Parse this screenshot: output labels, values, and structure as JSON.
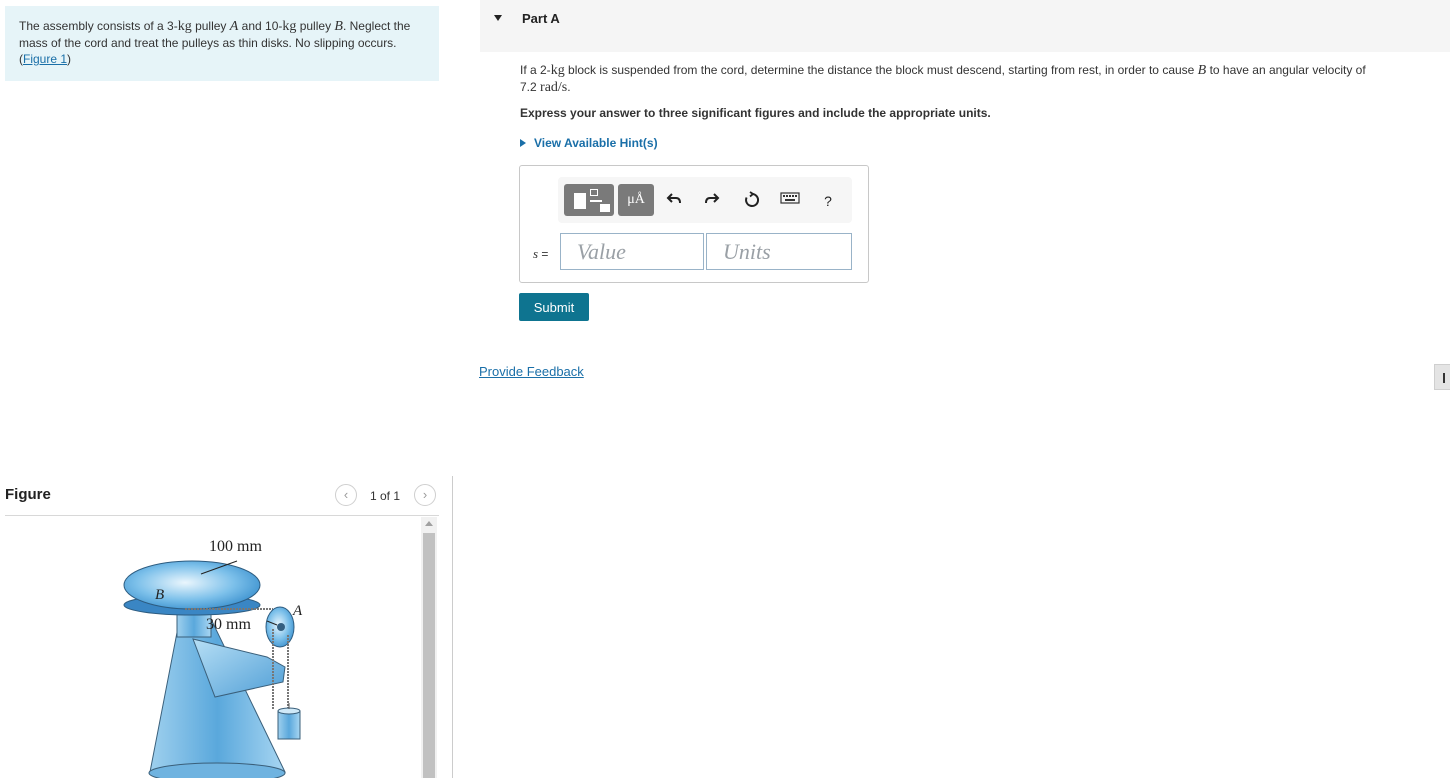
{
  "problem": {
    "text_1": "The assembly consists of a 3-",
    "kg_1": "kg",
    "text_2": " pulley ",
    "pulley_a": "A",
    "text_3": " and 10-",
    "kg_2": "kg",
    "text_4": " pulley ",
    "pulley_b": "B",
    "text_5": ". Neglect the mass of the cord and treat the pulleys as thin disks. No slipping occurs. (",
    "figure_link": "Figure 1",
    "text_6": ")"
  },
  "figure": {
    "title": "Figure",
    "pager": "1 of 1",
    "prev_icon": "‹",
    "next_icon": "›",
    "labels": {
      "radius_b": "100 mm",
      "pulley_b": "B",
      "radius_a": "30 mm",
      "pulley_a": "A"
    }
  },
  "part": {
    "title": "Part A",
    "q_1": "If a 2-",
    "q_kg": "kg",
    "q_2": " block is suspended from the cord, determine the distance the block must descend, starting from rest, in order to cause ",
    "q_b": "B",
    "q_3": " to have an angular velocity of ",
    "q_val": "7.2",
    "q_unit": "rad/s",
    "q_4": ".",
    "instruction": "Express your answer to three significant figures and include the appropriate units.",
    "hints": "View Available Hint(s)"
  },
  "answer": {
    "variable": "s",
    "equals": " =",
    "value_placeholder": "Value",
    "units_placeholder": "Units",
    "units_button": "μÅ",
    "help": "?"
  },
  "submit_label": "Submit",
  "feedback_label": "Provide Feedback",
  "colors": {
    "problem_bg": "#e6f4f8",
    "link": "#1a6fa8",
    "submit": "#0e7490"
  }
}
